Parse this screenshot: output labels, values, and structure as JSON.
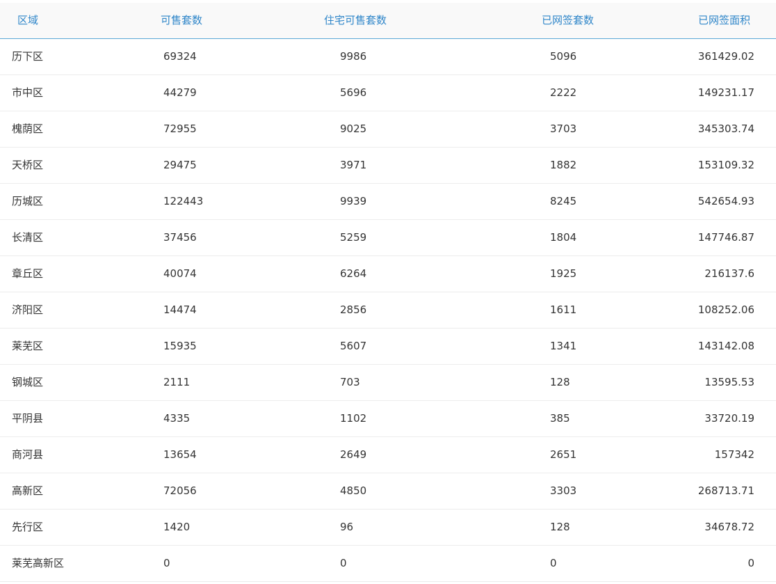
{
  "table": {
    "headers": [
      "区域",
      "可售套数",
      "住宅可售套数",
      "已网签套数",
      "已网签面积"
    ],
    "rows": [
      [
        "历下区",
        "69324",
        "9986",
        "5096",
        "361429.02"
      ],
      [
        "市中区",
        "44279",
        "5696",
        "2222",
        "149231.17"
      ],
      [
        "槐荫区",
        "72955",
        "9025",
        "3703",
        "345303.74"
      ],
      [
        "天桥区",
        "29475",
        "3971",
        "1882",
        "153109.32"
      ],
      [
        "历城区",
        "122443",
        "9939",
        "8245",
        "542654.93"
      ],
      [
        "长清区",
        "37456",
        "5259",
        "1804",
        "147746.87"
      ],
      [
        "章丘区",
        "40074",
        "6264",
        "1925",
        "216137.6"
      ],
      [
        "济阳区",
        "14474",
        "2856",
        "1611",
        "108252.06"
      ],
      [
        "莱芜区",
        "15935",
        "5607",
        "1341",
        "143142.08"
      ],
      [
        "钢城区",
        "2111",
        "703",
        "128",
        "13595.53"
      ],
      [
        "平阴县",
        "4335",
        "1102",
        "385",
        "33720.19"
      ],
      [
        "商河县",
        "13654",
        "2649",
        "2651",
        "157342"
      ],
      [
        "高新区",
        "72056",
        "4850",
        "3303",
        "268713.71"
      ],
      [
        "先行区",
        "1420",
        "96",
        "128",
        "34678.72"
      ],
      [
        "莱芜高新区",
        "0",
        "0",
        "0",
        "0"
      ]
    ]
  },
  "colors": {
    "header_text": "#2f86c9",
    "header_border": "#5aa8d6",
    "body_text": "#333333"
  }
}
